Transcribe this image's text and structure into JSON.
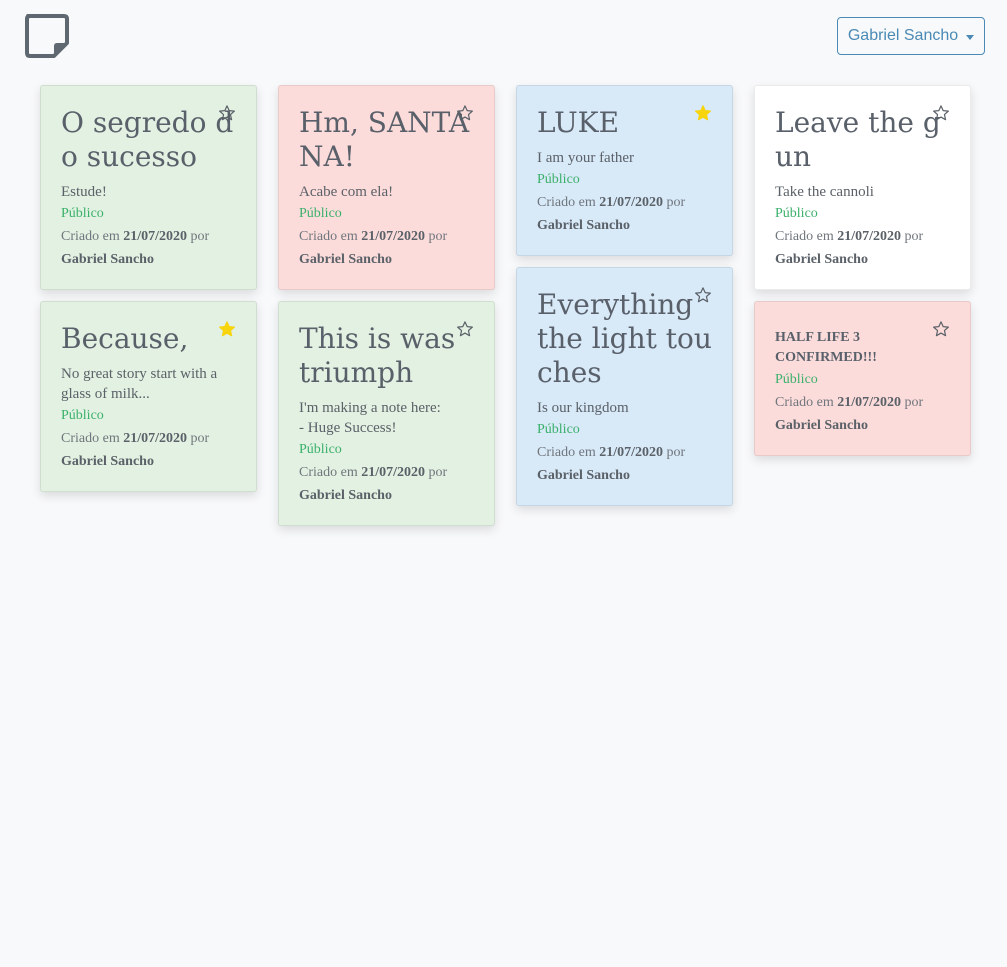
{
  "header": {
    "user_name": "Gabriel Sancho"
  },
  "labels": {
    "public": "Público",
    "created_prefix": "Criado em",
    "by": "por"
  },
  "colors": {
    "green": "#e2f1e2",
    "red": "#fcdcdb",
    "blue": "#d8e9f8",
    "white": "#ffffff",
    "star_active": "#f7d40c",
    "public_text": "#3ab06a",
    "user_button": "#4a8ab5"
  },
  "notes": {
    "n1": {
      "title": "O segredo do sucesso",
      "body": "Estude!",
      "visibility": "Público",
      "date": "21/07/2020",
      "author": "Gabriel Sancho",
      "starred": false
    },
    "n2": {
      "title": "Because,",
      "body": "No great story start with a glass of milk...",
      "visibility": "Público",
      "date": "21/07/2020",
      "author": "Gabriel Sancho",
      "starred": true
    },
    "n3": {
      "title": "Hm, SANTANA!",
      "body": "Acabe com ela!",
      "visibility": "Público",
      "date": "21/07/2020",
      "author": "Gabriel Sancho",
      "starred": false
    },
    "n4": {
      "title": "This is was triumph",
      "body": "I'm making a note here:\n- Huge Success!",
      "visibility": "Público",
      "date": "21/07/2020",
      "author": "Gabriel Sancho",
      "starred": false
    },
    "n5": {
      "title": "LUKE",
      "body": "I am your father",
      "visibility": "Público",
      "date": "21/07/2020",
      "author": "Gabriel Sancho",
      "starred": true
    },
    "n6": {
      "title": "Everything the light touches",
      "body": "Is our kingdom",
      "visibility": "Público",
      "date": "21/07/2020",
      "author": "Gabriel Sancho",
      "starred": false
    },
    "n7": {
      "title": "Leave the gun",
      "body": "Take the cannoli",
      "visibility": "Público",
      "date": "21/07/2020",
      "author": "Gabriel Sancho",
      "starred": false
    },
    "n8": {
      "title": "HALF LIFE 3 CONFIRMED!!!",
      "body": "",
      "visibility": "Público",
      "date": "21/07/2020",
      "author": "Gabriel Sancho",
      "starred": false
    }
  }
}
